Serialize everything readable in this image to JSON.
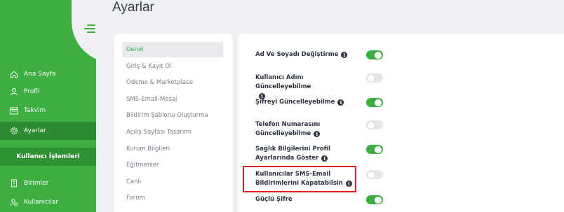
{
  "page_title": "Ayarlar",
  "sidebar": {
    "items": [
      {
        "label": "Ana Sayfa",
        "icon": "home-icon",
        "active": false
      },
      {
        "label": "Profil",
        "icon": "user-icon",
        "active": false
      },
      {
        "label": "Takvim",
        "icon": "calendar-icon",
        "active": false
      },
      {
        "label": "Ayarlar",
        "icon": "gear-icon",
        "active": true
      }
    ],
    "section_header": "Kullanıcı İşlemleri",
    "section_items": [
      {
        "label": "Birimler",
        "icon": "building-icon"
      },
      {
        "label": "Kullanıcılar",
        "icon": "users-icon"
      }
    ]
  },
  "settings_menu": {
    "items": [
      {
        "label": "Genel",
        "active": true
      },
      {
        "label": "Giriş & Kayıt Ol",
        "active": false
      },
      {
        "label": "Ödeme & Marketplace",
        "active": false
      },
      {
        "label": "SMS-Email-Mesaj",
        "active": false
      },
      {
        "label": "Bildirim Şablonu Oluşturma",
        "active": false
      },
      {
        "label": "Açılış Sayfası Tasarımı",
        "active": false
      },
      {
        "label": "Kurum Bilgileri",
        "active": false
      },
      {
        "label": "Eğitmenler",
        "active": false
      },
      {
        "label": "Canlı",
        "active": false
      },
      {
        "label": "Forum",
        "active": false
      }
    ]
  },
  "settings": [
    {
      "line1": "Ad Ve Soyadı Değiştirme",
      "line2": "",
      "enabled": true
    },
    {
      "line1": "Kullanıcı Adını Güncelleyebilme",
      "line2": "",
      "enabled": false
    },
    {
      "line1": "Şifreyi Güncelleyebilme",
      "line2": "",
      "enabled": true
    },
    {
      "line1": "Telefon Numarasını",
      "line2": "Güncelleyebilme",
      "enabled": false
    },
    {
      "line1": "Sağlık Bilgilerini Profil",
      "line2": "Ayarlarında Göster",
      "enabled": true
    },
    {
      "line1": "Kullanıcılar SMS-Email",
      "line2": "Bildirimlerini Kapatabilsin",
      "enabled": false
    },
    {
      "line1": "Güçlü Şifre",
      "line2": "",
      "enabled": true
    }
  ],
  "colors": {
    "accent": "#3dae41",
    "highlight": "#e02020"
  }
}
